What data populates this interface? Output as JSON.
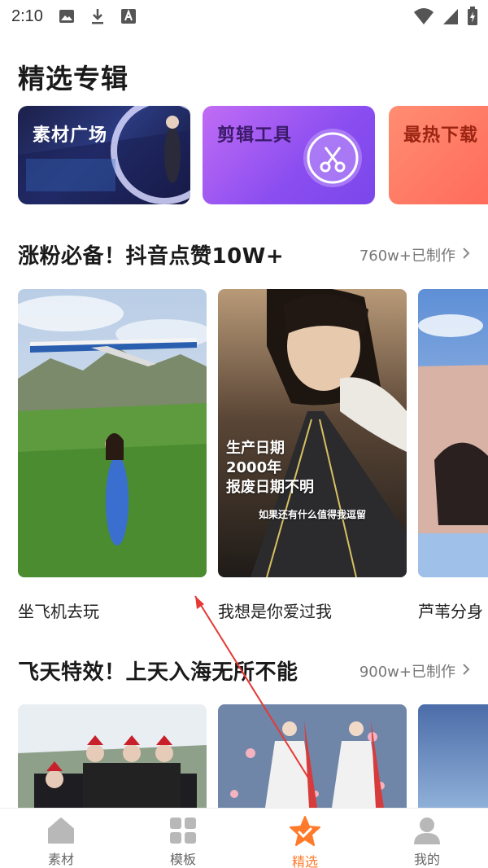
{
  "status_bar": {
    "time": "2:10"
  },
  "page": {
    "title": "精选专辑"
  },
  "albums": [
    {
      "label": "素材广场"
    },
    {
      "label": "剪辑工具"
    },
    {
      "label": "最热下载"
    }
  ],
  "sections": [
    {
      "title": "涨粉必备！抖音点赞10W+",
      "meta": "760w+已制作",
      "items": [
        {
          "name": "坐飞机去玩"
        },
        {
          "name": "我想是你爱过我",
          "overlay_lines": [
            "生产日期",
            "2000年",
            "报废日期不明"
          ],
          "caption": "如果还有什么值得我逗留"
        },
        {
          "name": "芦苇分身"
        }
      ]
    },
    {
      "title": "飞天特效！上天入海无所不能",
      "meta": "900w+已制作"
    }
  ],
  "bottom_nav": {
    "items": [
      {
        "label": "素材"
      },
      {
        "label": "模板"
      },
      {
        "label": "精选"
      },
      {
        "label": "我的"
      }
    ]
  },
  "colors": {
    "accent": "#ff7a2a"
  }
}
